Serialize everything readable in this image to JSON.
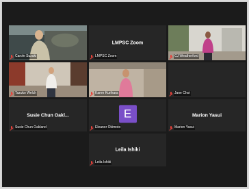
{
  "meeting": {
    "title": "LMPSC Zoom"
  },
  "participants": [
    {
      "id": "carole",
      "name": "Carole Suzuki",
      "muted": true,
      "video": true,
      "active": false
    },
    {
      "id": "lmpsc",
      "name": "LMPSC Zoom",
      "label": "LMPSC Zoom",
      "muted": true,
      "video": false,
      "active": false
    },
    {
      "id": "cj",
      "name": "CJ Weatherford",
      "muted": true,
      "video": true,
      "active": true
    },
    {
      "id": "tazuko",
      "name": "Tazuko Welch",
      "muted": true,
      "video": true,
      "active": false
    },
    {
      "id": "karen",
      "name": "Karen Kurihara",
      "muted": true,
      "video": true,
      "active": false
    },
    {
      "id": "jane",
      "name": "Jane Choi",
      "muted": true,
      "video": false,
      "active": false
    },
    {
      "id": "susie",
      "name": "Susie Chun Oakland",
      "label": "Susie Chun Oakl...",
      "muted": true,
      "video": false,
      "active": false
    },
    {
      "id": "eleanor",
      "name": "Eleanor Okimoto",
      "avatar_letter": "E",
      "muted": true,
      "video": false,
      "active": false
    },
    {
      "id": "marion",
      "name": "Marion Yasui",
      "label": "Marion Yasui",
      "muted": true,
      "video": false,
      "active": false
    },
    {
      "id": "leila",
      "name": "Leila Ishiki",
      "label": "Leila Ishiki",
      "muted": true,
      "video": false,
      "active": false
    }
  ],
  "colors": {
    "active_border": "#b6e33a",
    "mute": "#e8403a",
    "avatar_bg": "#7a4fc8"
  }
}
